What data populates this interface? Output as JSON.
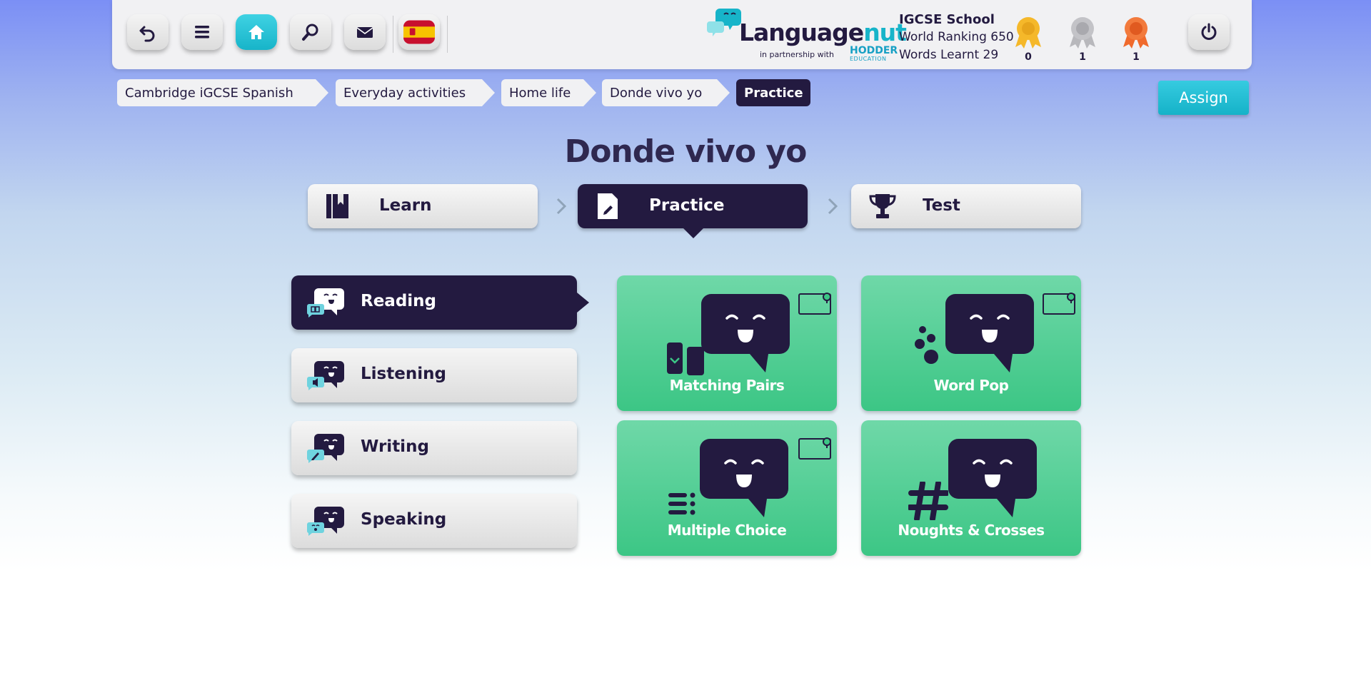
{
  "header": {
    "buttons": [
      {
        "name": "back-button",
        "icon": "undo-icon"
      },
      {
        "name": "menu-button",
        "icon": "hamburger-icon"
      },
      {
        "name": "home-button",
        "icon": "home-icon"
      },
      {
        "name": "search-button",
        "icon": "search-icon"
      },
      {
        "name": "messages-button",
        "icon": "envelope-icon"
      },
      {
        "name": "language-button",
        "icon": "spain-flag-icon"
      }
    ],
    "logo": {
      "word_main": "Language",
      "word_accent": "nut",
      "partner": "in partnership with",
      "partner_brand": "HODDER",
      "partner_sub": "EDUCATION"
    },
    "school": {
      "name": "IGCSE School",
      "ranking": "World Ranking 650",
      "words": "Words Learnt 29"
    },
    "medals": [
      {
        "name": "gold",
        "count": "0",
        "color": "#f5b82a"
      },
      {
        "name": "silver",
        "count": "1",
        "color": "#b8b8bc"
      },
      {
        "name": "bronze",
        "count": "1",
        "color": "#f06a2c"
      }
    ]
  },
  "breadcrumb": [
    "Cambridge iGCSE Spanish",
    "Everyday activities",
    "Home life",
    "Donde vivo yo",
    "Practice"
  ],
  "assign_label": "Assign",
  "page_title": "Donde vivo yo",
  "stages": [
    {
      "label": "Learn",
      "active": false
    },
    {
      "label": "Practice",
      "active": true
    },
    {
      "label": "Test",
      "active": false
    }
  ],
  "skills": [
    {
      "label": "Reading",
      "active": true
    },
    {
      "label": "Listening",
      "active": false
    },
    {
      "label": "Writing",
      "active": false
    },
    {
      "label": "Speaking",
      "active": false
    }
  ],
  "games": [
    {
      "label": "Matching Pairs",
      "hint": true
    },
    {
      "label": "Word Pop",
      "hint": true
    },
    {
      "label": "Multiple Choice",
      "hint": true
    },
    {
      "label": "Noughts & Crosses",
      "hint": false
    }
  ],
  "colors": {
    "dark": "#231a40",
    "accent": "#17b4c9",
    "tile": "#3cc685"
  }
}
